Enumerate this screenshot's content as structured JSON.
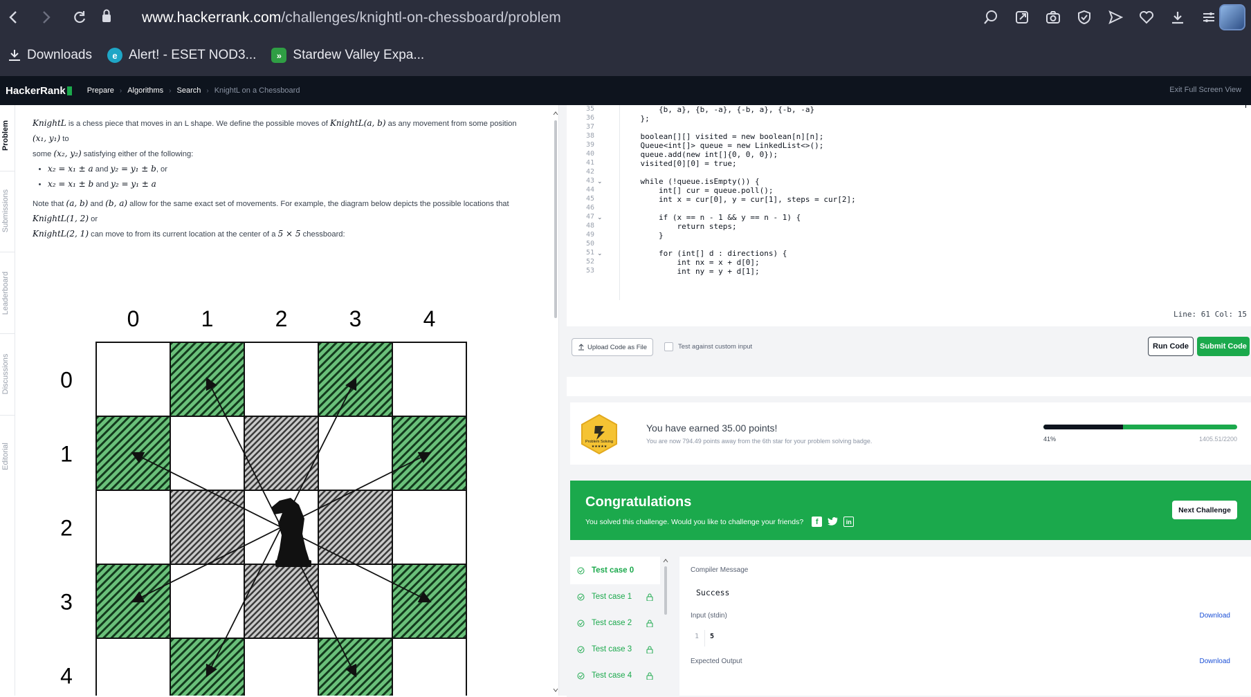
{
  "browser": {
    "url_host": "www.hackerrank.com",
    "url_path": "/challenges/knightl-on-chessboard/problem",
    "bookmarks": [
      {
        "label": "Downloads",
        "icon": "download-icon"
      },
      {
        "label": "Alert! - ESET NOD3...",
        "icon": "eset-icon",
        "color": "#1fa6c6"
      },
      {
        "label": "Stardew Valley Expa...",
        "icon": "stardew-icon",
        "color": "#2f9e44"
      }
    ]
  },
  "header": {
    "logo": "HackerRank",
    "breadcrumbs": [
      "Prepare",
      "Algorithms",
      "Search",
      "KnightL on a Chessboard"
    ],
    "exit_full_screen": "Exit Full Screen View"
  },
  "side_tabs": [
    "Problem",
    "Submissions",
    "Leaderboard",
    "Discussions",
    "Editorial"
  ],
  "problem": {
    "p1_a": "is a chess piece that moves in an L shape. We define the possible moves of",
    "p1_b": "as any movement from some position",
    "p1_c": "to",
    "p1_d": "some",
    "p1_e": "satisfying either of the following:",
    "knightl": "KnightL",
    "knightl_ab": "KnightL(a, b)",
    "pos1": "(x₁, y₁)",
    "pos2": "(x₂, y₂)",
    "b1_a": "x₂ = x₁ ± a",
    "b1_and": "and",
    "b1_b": "y₂ = y₁ ± b",
    "b1_or": ", or",
    "b2_a": "x₂ = x₁ ± b",
    "b2_b": "y₂ = y₁ ± a",
    "p2_a": "Note that",
    "ab": "(a, b)",
    "p2_and": "and",
    "ba": "(b, a)",
    "p2_b": "allow for the same exact set of movements. For example, the diagram below depicts the possible locations that",
    "k12": "KnightL(1, 2)",
    "p2_or": "or",
    "k21": "KnightL(2, 1)",
    "p2_c": "can move to from its current location at the center of a",
    "size": "5 × 5",
    "p2_d": "chessboard:"
  },
  "board": {
    "col_labels": [
      "0",
      "1",
      "2",
      "3",
      "4"
    ],
    "row_labels": [
      "0",
      "1",
      "2",
      "3",
      "4"
    ],
    "green_cells": [
      [
        0,
        1
      ],
      [
        0,
        3
      ],
      [
        1,
        0
      ],
      [
        1,
        4
      ],
      [
        3,
        0
      ],
      [
        3,
        4
      ],
      [
        4,
        1
      ],
      [
        4,
        3
      ]
    ],
    "gray_cells": [
      [
        1,
        2
      ],
      [
        2,
        1
      ],
      [
        2,
        3
      ],
      [
        3,
        2
      ]
    ],
    "knight_cell": [
      2,
      2
    ],
    "colors": {
      "green": "#6ac07a",
      "gray": "#9a9a9a",
      "grid": "#111111"
    }
  },
  "editor": {
    "lines": [
      {
        "n": "35",
        "code": "        {b, a}, {b, -a}, {-b, a}, {-b, -a}"
      },
      {
        "n": "36",
        "code": "    };"
      },
      {
        "n": "37",
        "code": ""
      },
      {
        "n": "38",
        "code": "    boolean[][] visited = new boolean[n][n];"
      },
      {
        "n": "39",
        "code": "    Queue<int[]> queue = new LinkedList<>();"
      },
      {
        "n": "40",
        "code": "    queue.add(new int[]{0, 0, 0});"
      },
      {
        "n": "41",
        "code": "    visited[0][0] = true;"
      },
      {
        "n": "42",
        "code": ""
      },
      {
        "n": "43",
        "code": "    while (!queue.isEmpty()) {"
      },
      {
        "n": "44",
        "code": "        int[] cur = queue.poll();"
      },
      {
        "n": "45",
        "code": "        int x = cur[0], y = cur[1], steps = cur[2];"
      },
      {
        "n": "46",
        "code": ""
      },
      {
        "n": "47",
        "code": "        if (x == n - 1 && y == n - 1) {"
      },
      {
        "n": "48",
        "code": "            return steps;"
      },
      {
        "n": "49",
        "code": "        }"
      },
      {
        "n": "50",
        "code": ""
      },
      {
        "n": "51",
        "code": "        for (int[] d : directions) {"
      },
      {
        "n": "52",
        "code": "            int nx = x + d[0];"
      },
      {
        "n": "53",
        "code": "            int ny = y + d[1];"
      }
    ],
    "line_col": "Line: 61 Col: 15"
  },
  "actions": {
    "upload": "Upload Code as File",
    "custom_input": "Test against custom input",
    "run": "Run Code",
    "submit": "Submit Code"
  },
  "points": {
    "badge_label": "Problem Solving",
    "earned": "You have earned 35.00 points!",
    "away": "You are now 794.49 points away from the 6th star for your problem solving badge.",
    "percent_label": "41%",
    "progress": 0.41,
    "score": "1405.51/2200"
  },
  "congrats": {
    "title": "Congratulations",
    "subtitle": "You solved this challenge. Would you like to challenge your friends?",
    "next": "Next Challenge"
  },
  "test_cases": [
    "Test case 0",
    "Test case 1",
    "Test case 2",
    "Test case 3",
    "Test case 4"
  ],
  "results": {
    "compiler_label": "Compiler Message",
    "compiler_msg": "Success",
    "input_label": "Input (stdin)",
    "input_line_no": "1",
    "input_value": "5",
    "download": "Download",
    "expected_label": "Expected Output"
  }
}
